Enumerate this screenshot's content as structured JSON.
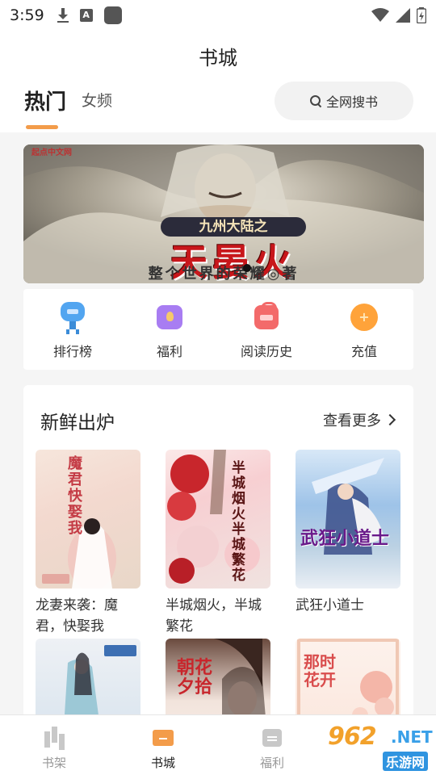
{
  "status_bar": {
    "time": "3:59",
    "a_badge": "A"
  },
  "header": {
    "title": "书城",
    "tabs": [
      {
        "label": "热门",
        "active": true
      },
      {
        "label": "女频",
        "active": false
      }
    ],
    "search_label": "全网搜书"
  },
  "banner": {
    "top_text": "起点中文网",
    "subtitle": "九州大陆之",
    "main_title": "天晏火",
    "author": "整个世界的荣耀◎著"
  },
  "quick_menu": [
    {
      "label": "排行榜",
      "icon": "trophy-icon"
    },
    {
      "label": "福利",
      "icon": "gift-icon"
    },
    {
      "label": "阅读历史",
      "icon": "history-icon"
    },
    {
      "label": "充值",
      "icon": "recharge-icon"
    }
  ],
  "fresh": {
    "title": "新鲜出炉",
    "more_label": "查看更多",
    "books": [
      {
        "title": "龙妻来袭：魔君，快娶我",
        "cover_text": "魔君快娶我"
      },
      {
        "title": "半城烟火，半城繁花",
        "cover_text": "半城烟火 半城繁花"
      },
      {
        "title": "武狂小道士",
        "cover_text": "武狂小道士"
      },
      {
        "title": "",
        "cover_text": ""
      },
      {
        "title": "",
        "cover_text": "朝花夕拾"
      },
      {
        "title": "",
        "cover_text": "那时花开"
      }
    ]
  },
  "tabbar": [
    {
      "label": "书架",
      "active": false
    },
    {
      "label": "书城",
      "active": true
    },
    {
      "label": "福利",
      "active": false
    }
  ],
  "watermark": {
    "number": "962",
    "domain": ".NET",
    "text": "乐游网"
  },
  "colors": {
    "accent": "#f39c4a",
    "background": "#f5f5f5"
  }
}
